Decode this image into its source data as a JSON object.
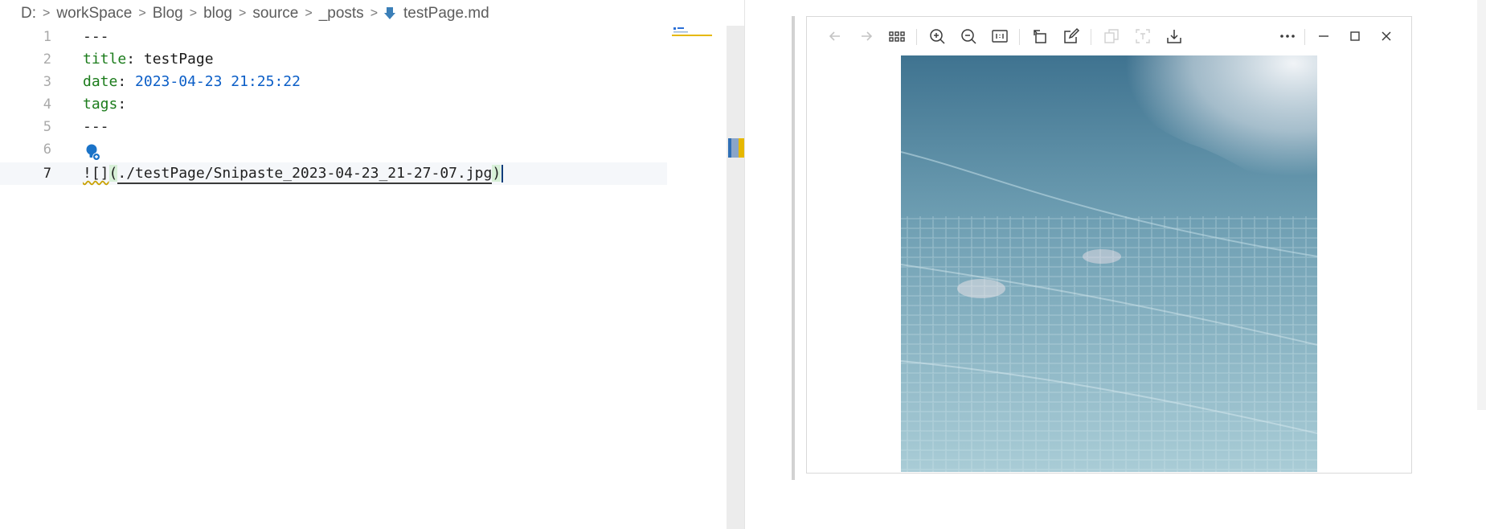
{
  "breadcrumb": {
    "items": [
      "D:",
      "workSpace",
      "Blog",
      "blog",
      "source",
      "_posts"
    ],
    "file": "testPage.md"
  },
  "editor": {
    "lines": [
      {
        "num": "1",
        "text": "---"
      },
      {
        "num": "2",
        "key": "title",
        "colon": ": ",
        "value": "testPage"
      },
      {
        "num": "3",
        "key": "date",
        "colon": ": ",
        "value": "2023-04-23 21:25:22"
      },
      {
        "num": "4",
        "key": "tags",
        "colon": ":"
      },
      {
        "num": "5",
        "text": "---"
      },
      {
        "num": "6",
        "text": ""
      },
      {
        "num": "7",
        "prefix": "![]",
        "open": "(",
        "path": "./testPage/Snipaste_2023-04-23_21-27-07.jpg",
        "close": ")"
      }
    ],
    "active_line": "7"
  },
  "viewer": {
    "toolbar": [
      "back-icon",
      "forward-icon",
      "grid-icon",
      "zoom-in-icon",
      "zoom-out-icon",
      "actual-size-icon",
      "rotate-icon",
      "edit-icon",
      "copy-icon",
      "ocr-icon",
      "download-icon",
      "more-icon",
      "minimize-icon",
      "maximize-icon",
      "close-icon"
    ],
    "colors": {
      "water_dark": "#3f7390",
      "water_light": "#9cc4d1",
      "foam": "#e8eef3"
    }
  }
}
